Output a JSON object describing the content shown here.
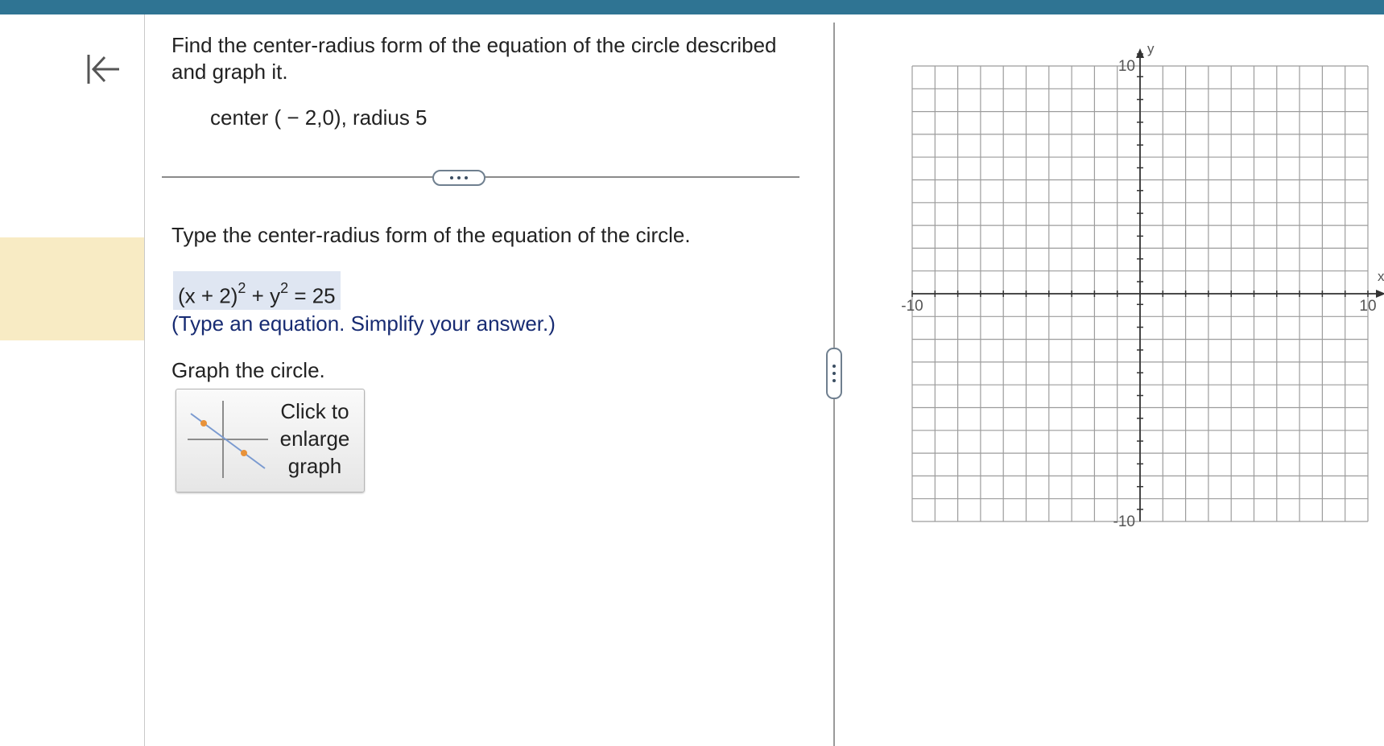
{
  "question": {
    "instruction": "Find the center-radius form of the equation of the circle described and graph it.",
    "given": "center ( − 2,0), radius 5"
  },
  "part1": {
    "prompt": "Type the center-radius form of the equation of the circle.",
    "answer_parts": [
      "(x + 2)",
      "2",
      " + y",
      "2",
      " = 25"
    ],
    "hint": "(Type an equation. Simplify your answer.)"
  },
  "part2": {
    "prompt": "Graph the circle.",
    "enlarge_button": {
      "line1": "Click to",
      "line2": "enlarge",
      "line3": "graph"
    }
  },
  "graph": {
    "x_label": "x",
    "y_label": "y",
    "x_min_label": "-10",
    "x_max_label": "10",
    "y_max_label": "10",
    "y_min_label": "-10",
    "x_range": [
      -10,
      10
    ],
    "y_range": [
      -10,
      10
    ],
    "grid": true
  },
  "icons": {
    "collapse": "arrow-left-to-bar-icon",
    "more": "ellipsis-icon",
    "splitter": "vertical-ellipsis-icon"
  },
  "colors": {
    "topbar": "#2f7493",
    "rail_highlight": "#f8ebc4",
    "answer_bg": "#dfe6f2",
    "hint_text": "#172b72"
  }
}
